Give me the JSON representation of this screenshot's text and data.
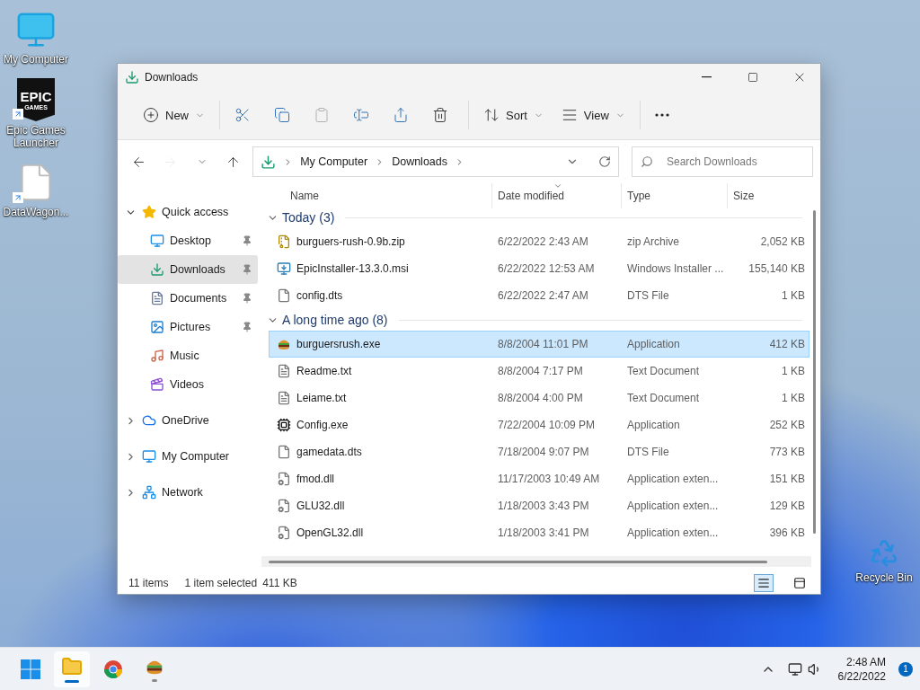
{
  "desktop_icons": [
    {
      "kind": "computer",
      "label": "My Computer",
      "shortcut": false
    },
    {
      "kind": "epic",
      "label": "Epic Games Launcher",
      "shortcut": true,
      "logo_lines": [
        "EPIC",
        "GAMES"
      ]
    },
    {
      "kind": "file",
      "label": "DataWagon...",
      "shortcut": true
    }
  ],
  "recycle_bin": {
    "label": "Recycle Bin"
  },
  "window": {
    "title": "Downloads",
    "toolbar": [
      {
        "items": [
          {
            "kind": "new",
            "label": "New",
            "menu": true,
            "disabled": false
          }
        ]
      },
      {
        "items": [
          {
            "kind": "cut",
            "menu": false,
            "disabled": false
          },
          {
            "kind": "copy",
            "menu": false,
            "disabled": false
          },
          {
            "kind": "paste",
            "menu": false,
            "disabled": true
          },
          {
            "kind": "rename",
            "menu": false,
            "disabled": false
          },
          {
            "kind": "share",
            "menu": false,
            "disabled": false
          },
          {
            "kind": "delete",
            "menu": false,
            "disabled": false
          }
        ]
      },
      {
        "items": [
          {
            "kind": "sort",
            "label": "Sort",
            "menu": true,
            "disabled": false
          },
          {
            "kind": "view",
            "label": "View",
            "menu": true,
            "disabled": false
          }
        ]
      },
      {
        "items": [
          {
            "kind": "more",
            "menu": false,
            "disabled": false
          }
        ]
      }
    ],
    "nav": [
      {
        "kind": "back",
        "disabled": false
      },
      {
        "kind": "forward",
        "disabled": true
      },
      {
        "kind": "recent",
        "disabled": false
      },
      {
        "kind": "up",
        "disabled": false
      }
    ],
    "breadcrumbs": [
      "My Computer",
      "Downloads"
    ],
    "search": {
      "placeholder": "Search Downloads"
    },
    "sidebar": [
      {
        "kind": "star",
        "label": "Quick access",
        "expanded": true,
        "selected": false,
        "children": [
          {
            "kind": "desktop",
            "label": "Desktop",
            "pinned": true,
            "selected": false
          },
          {
            "kind": "download",
            "label": "Downloads",
            "pinned": true,
            "selected": true
          },
          {
            "kind": "documents",
            "label": "Documents",
            "pinned": true,
            "selected": false
          },
          {
            "kind": "pictures",
            "label": "Pictures",
            "pinned": true,
            "selected": false
          },
          {
            "kind": "music",
            "label": "Music",
            "pinned": false,
            "selected": false
          },
          {
            "kind": "videos",
            "label": "Videos",
            "pinned": false,
            "selected": false
          }
        ]
      },
      {
        "kind": "cloud",
        "label": "OneDrive",
        "expanded": false,
        "selected": false
      },
      {
        "kind": "computer",
        "label": "My Computer",
        "expanded": false,
        "selected": false
      },
      {
        "kind": "network",
        "label": "Network",
        "expanded": false,
        "selected": false
      }
    ],
    "columns": [
      {
        "label": "Name",
        "sorted": false
      },
      {
        "label": "Date modified",
        "sorted": true
      },
      {
        "label": "Type",
        "sorted": false
      },
      {
        "label": "Size",
        "sorted": false
      }
    ],
    "groups": [
      {
        "label": "Today (3)",
        "expanded": true,
        "rows": [
          {
            "kind": "zip",
            "name": "burguers-rush-0.9b.zip",
            "date": "6/22/2022 2:43 AM",
            "type": "zip Archive",
            "size": "2,052 KB",
            "selected": false
          },
          {
            "kind": "installer",
            "name": "EpicInstaller-13.3.0.msi",
            "date": "6/22/2022 12:53 AM",
            "type": "Windows Installer ...",
            "size": "155,140 KB",
            "selected": false
          },
          {
            "kind": "blank",
            "name": "config.dts",
            "date": "6/22/2022 2:47 AM",
            "type": "DTS File",
            "size": "1 KB",
            "selected": false
          }
        ]
      },
      {
        "label": "A long time ago (8)",
        "expanded": true,
        "rows": [
          {
            "kind": "burger",
            "name": "burguersrush.exe",
            "date": "8/8/2004 11:01 PM",
            "type": "Application",
            "size": "412 KB",
            "selected": true
          },
          {
            "kind": "text",
            "name": "Readme.txt",
            "date": "8/8/2004 7:17 PM",
            "type": "Text Document",
            "size": "1 KB",
            "selected": false
          },
          {
            "kind": "text",
            "name": "Leiame.txt",
            "date": "8/8/2004 4:00 PM",
            "type": "Text Document",
            "size": "1 KB",
            "selected": false
          },
          {
            "kind": "chip",
            "name": "Config.exe",
            "date": "7/22/2004 10:09 PM",
            "type": "Application",
            "size": "252 KB",
            "selected": false
          },
          {
            "kind": "blank",
            "name": "gamedata.dts",
            "date": "7/18/2004 9:07 PM",
            "type": "DTS File",
            "size": "773 KB",
            "selected": false
          },
          {
            "kind": "dll",
            "name": "fmod.dll",
            "date": "11/17/2003 10:49 AM",
            "type": "Application exten...",
            "size": "151 KB",
            "selected": false
          },
          {
            "kind": "dll",
            "name": "GLU32.dll",
            "date": "1/18/2003 3:43 PM",
            "type": "Application exten...",
            "size": "129 KB",
            "selected": false
          },
          {
            "kind": "dll",
            "name": "OpenGL32.dll",
            "date": "1/18/2003 3:41 PM",
            "type": "Application exten...",
            "size": "396 KB",
            "selected": false
          }
        ]
      }
    ],
    "status": [
      "11 items",
      "1 item selected",
      "411 KB"
    ],
    "views": [
      {
        "kind": "details",
        "selected": true
      },
      {
        "kind": "tiles",
        "selected": false
      }
    ]
  },
  "taskbar": {
    "apps": [
      {
        "kind": "start",
        "running": false,
        "selected": false
      },
      {
        "kind": "folder",
        "running": true,
        "selected": true
      },
      {
        "kind": "browser",
        "running": false,
        "selected": false
      },
      {
        "kind": "burger",
        "running": true,
        "selected": false
      }
    ],
    "time": "2:48 AM",
    "date": "6/22/2022",
    "badge": "1"
  }
}
